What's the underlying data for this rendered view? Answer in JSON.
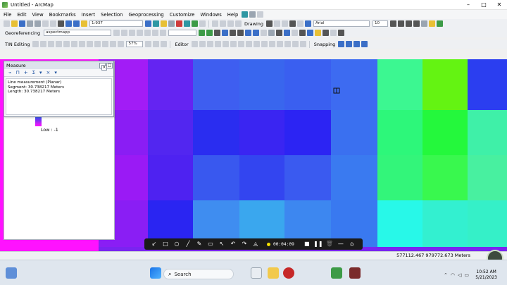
{
  "window": {
    "title": "Untitled - ArcMap",
    "controls": [
      "–",
      "□",
      "✕"
    ]
  },
  "menu": [
    "File",
    "Edit",
    "View",
    "Bookmarks",
    "Insert",
    "Selection",
    "Geoprocessing",
    "Customize",
    "Windows",
    "Help"
  ],
  "toolbar1": {
    "scale": "1:937",
    "drawing_label": "Drawing",
    "font_name": "Arial",
    "font_size": "10"
  },
  "toolbar2": {
    "georef_label": "Georeferencing",
    "layer_value": "aspectmapp"
  },
  "toolbar3": {
    "tin_label": "TIN Editing",
    "editor_label": "Editor",
    "snapping_label": "Snapping",
    "zoom_pct": "57%"
  },
  "toc": {
    "low_label": "Low : -1"
  },
  "measure": {
    "title": "Measure",
    "line1": "Line measurement (Planar)",
    "line2": "Segment: 30.738217 Meters",
    "line3": "Length: 30.738217 Meters"
  },
  "recorder": {
    "time": "00:04:09"
  },
  "status": {
    "coords": "577112.467  979772.673 Meters"
  },
  "taskbar": {
    "search_label": "Search",
    "time": "10:52 AM",
    "date": "5/21/2023"
  },
  "colors": {
    "accent": "#3b6fc7",
    "raster_green": "#33ff66",
    "raster_blue": "#2a40f0"
  }
}
